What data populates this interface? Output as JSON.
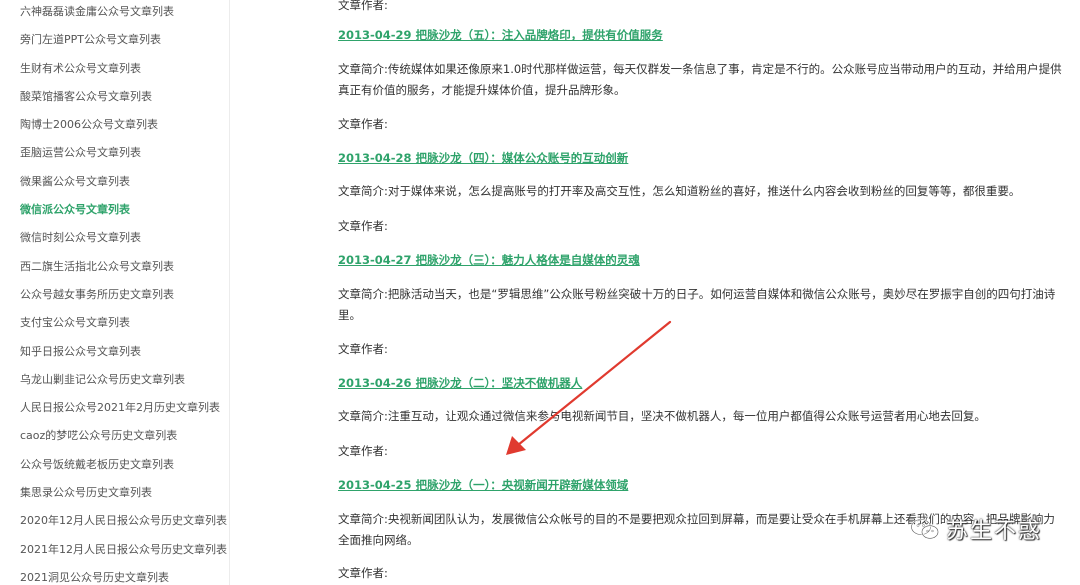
{
  "sidebar": {
    "items": [
      {
        "label": "六神磊磊读金庸公众号文章列表",
        "active": false
      },
      {
        "label": "旁门左道PPT公众号文章列表",
        "active": false
      },
      {
        "label": "生财有术公众号文章列表",
        "active": false
      },
      {
        "label": "酸菜馆播客公众号文章列表",
        "active": false
      },
      {
        "label": "陶博士2006公众号文章列表",
        "active": false
      },
      {
        "label": "歪脑运营公众号文章列表",
        "active": false
      },
      {
        "label": "微果酱公众号文章列表",
        "active": false
      },
      {
        "label": "微信派公众号文章列表",
        "active": true
      },
      {
        "label": "微信时刻公众号文章列表",
        "active": false
      },
      {
        "label": "西二旗生活指北公众号文章列表",
        "active": false
      },
      {
        "label": "公众号越女事务所历史文章列表",
        "active": false
      },
      {
        "label": "支付宝公众号文章列表",
        "active": false
      },
      {
        "label": "知乎日报公众号文章列表",
        "active": false
      },
      {
        "label": "乌龙山剿韭记公众号历史文章列表",
        "active": false
      },
      {
        "label": "人民日报公众号2021年2月历史文章列表",
        "active": false
      },
      {
        "label": "caoz的梦呓公众号历史文章列表",
        "active": false
      },
      {
        "label": "公众号饭统戴老板历史文章列表",
        "active": false
      },
      {
        "label": "集思录公众号历史文章列表",
        "active": false
      },
      {
        "label": "2020年12月人民日报公众号历史文章列表",
        "active": false
      },
      {
        "label": "2021年12月人民日报公众号历史文章列表",
        "active": false
      },
      {
        "label": "2021洞见公众号历史文章列表",
        "active": false
      }
    ]
  },
  "main": {
    "top_author": "文章作者:",
    "articles": [
      {
        "title": "2013-04-29 把脉沙龙（五）：注入品牌烙印，提供有价值服务",
        "summary": "文章简介:传统媒体如果还像原来1.0时代那样做运营，每天仅群发一条信息了事，肯定是不行的。公众账号应当带动用户的互动，并给用户提供真正有价值的服务，才能提升媒体价值，提升品牌形象。",
        "author": "文章作者:"
      },
      {
        "title": "2013-04-28 把脉沙龙（四）：媒体公众账号的互动创新",
        "summary": "文章简介:对于媒体来说，怎么提高账号的打开率及高交互性，怎么知道粉丝的喜好，推送什么内容会收到粉丝的回复等等，都很重要。",
        "author": "文章作者:"
      },
      {
        "title": "2013-04-27 把脉沙龙（三）：魅力人格体是自媒体的灵魂",
        "summary": "文章简介:把脉活动当天，也是“罗辑思维”公众账号粉丝突破十万的日子。如何运营自媒体和微信公众账号，奥妙尽在罗振宇自创的四句打油诗里。",
        "author": "文章作者:"
      },
      {
        "title": "2013-04-26 把脉沙龙（二）：坚决不做机器人",
        "summary": "文章简介:注重互动，让观众通过微信来参与电视新闻节目，坚决不做机器人，每一位用户都值得公众账号运营者用心地去回复。",
        "author": "文章作者:"
      },
      {
        "title": "2013-04-25 把脉沙龙（一）：央视新闻开辟新媒体领域",
        "summary": "文章简介:央视新闻团队认为，发展微信公众帐号的目的不是要把观众拉回到屏幕，而是要让受众在手机屏幕上还看我们的内容，把品牌影响力全面推向网络。",
        "author": "文章作者:"
      }
    ]
  },
  "watermark": {
    "text": "苏生不惑",
    "icon": "wechat-icon"
  },
  "colors": {
    "accent": "#2fa36b",
    "arrow": "#e03a2f",
    "text": "#333333"
  }
}
